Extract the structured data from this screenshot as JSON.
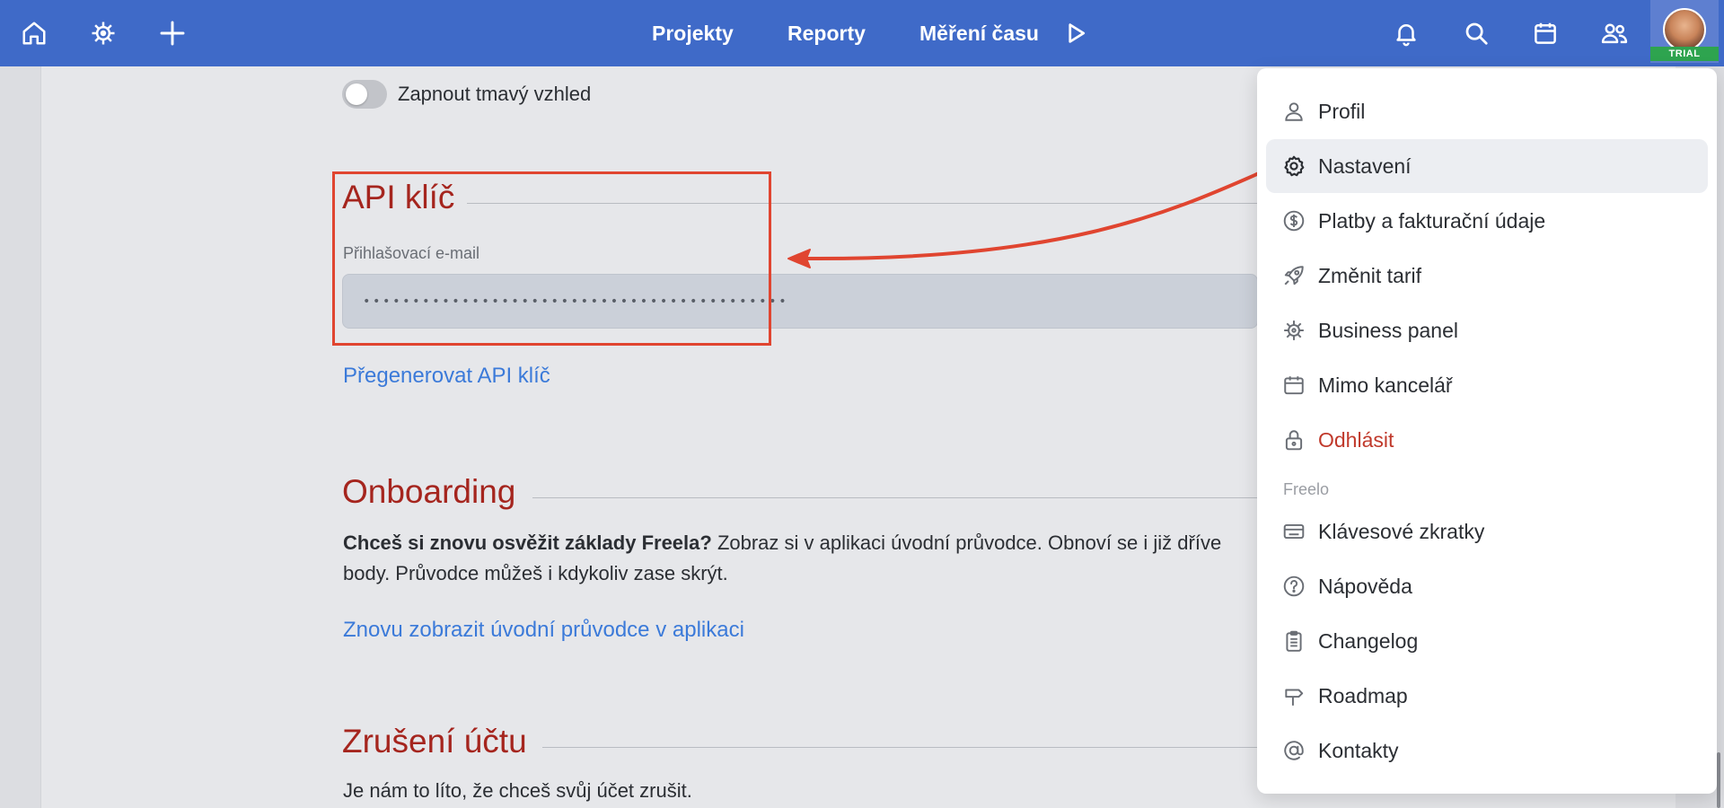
{
  "topbar": {
    "nav": [
      "Projekty",
      "Reporty",
      "Měření času"
    ],
    "trial_badge": "TRIAL",
    "color": "#3f6ac8"
  },
  "icons": {
    "home": "home-icon",
    "business": "ship-wheel-icon",
    "add": "plus-icon",
    "timer": "play-icon",
    "notifications": "bell-icon",
    "search": "search-icon",
    "calendar": "calendar-icon",
    "people": "users-icon"
  },
  "settings": {
    "dark_mode_label": "Zapnout tmavý vzhled",
    "dark_mode_enabled": false,
    "api": {
      "title": "API klíč",
      "field_label": "Přihlašovací e-mail",
      "masked_value": "•••••••••••••••••••••••••••••••••••••••••••",
      "regenerate_link": "Přegenerovat API klíč"
    },
    "onboarding": {
      "title": "Onboarding",
      "lead_bold": "Chceš si znovu osvěžit základy Freela?",
      "text_line1": " Zobraz si v aplikaci úvodní průvodce. Obnoví se i již dříve",
      "text_line2": "body. Průvodce můžeš i kdykoliv zase skrýt.",
      "link": "Znovu zobrazit úvodní průvodce v aplikaci"
    },
    "cancel": {
      "title": "Zrušení účtu",
      "text": "Je nám to líto, že chceš svůj účet zrušit."
    }
  },
  "menu": {
    "items": [
      {
        "label": "Profil",
        "icon": "user-icon"
      },
      {
        "label": "Nastavení",
        "icon": "gear-icon"
      },
      {
        "label": "Platby a fakturační údaje",
        "icon": "dollar-circle-icon"
      },
      {
        "label": "Změnit tarif",
        "icon": "rocket-icon"
      },
      {
        "label": "Business panel",
        "icon": "ship-wheel-icon"
      },
      {
        "label": "Mimo kancelář",
        "icon": "calendar-icon"
      },
      {
        "label": "Odhlásit",
        "icon": "lock-icon"
      }
    ],
    "section_label": "Freelo",
    "section_items": [
      {
        "label": "Klávesové zkratky",
        "icon": "keyboard-icon"
      },
      {
        "label": "Nápověda",
        "icon": "help-circle-icon"
      },
      {
        "label": "Changelog",
        "icon": "clipboard-icon"
      },
      {
        "label": "Roadmap",
        "icon": "signpost-icon"
      },
      {
        "label": "Kontakty",
        "icon": "at-sign-icon"
      }
    ],
    "active_item": "Nastavení"
  },
  "colors": {
    "section_title": "#a5251e",
    "link": "#3b7ad9",
    "annotation": "#e04530",
    "danger": "#c0392b"
  }
}
